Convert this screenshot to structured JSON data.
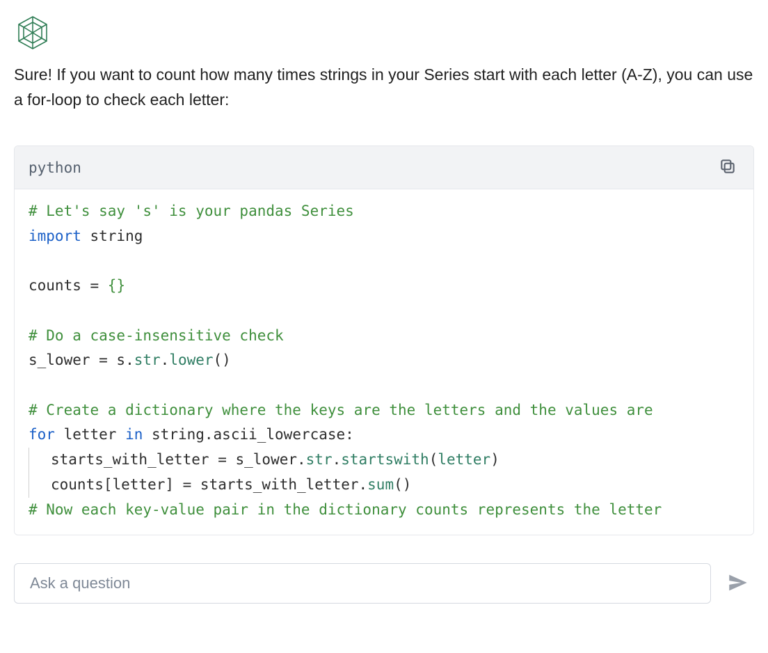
{
  "logo": {
    "name": "hex-knot-icon"
  },
  "answer": {
    "text": "Sure! If you want to count how many times strings in your Series start with each letter (A-Z), you can use a for-loop to check each letter:"
  },
  "code_block": {
    "language": "python",
    "copy_label": "Copy",
    "lines": {
      "c1": "# Let's say 's' is your pandas Series",
      "kw_import": "import",
      "mod_string": " string",
      "counts_eq": "counts = ",
      "braces": "{}",
      "c2": "# Do a case-insensitive check",
      "sl_pre": "s_lower = s.",
      "sl_str": "str",
      "sl_dot": ".",
      "sl_lower": "lower",
      "sl_paren": "()",
      "c3": "# Create a dictionary where the keys are the letters and the values are",
      "kw_for": "for",
      "for_mid": " letter ",
      "kw_in": "in",
      "for_tail": " string.ascii_lowercase:",
      "l_sw_pre": "starts_with_letter = s_lower.",
      "l_sw_str": "str",
      "l_sw_dot": ".",
      "l_sw_sw": "startswith",
      "l_sw_paren_open": "(",
      "l_sw_arg": "letter",
      "l_sw_paren_close": ")",
      "l_cnt_pre": "counts[letter] = starts_with_letter.",
      "l_cnt_sum": "sum",
      "l_cnt_paren": "()",
      "c4": "# Now each key-value pair in the dictionary counts represents the letter"
    }
  },
  "input": {
    "placeholder": "Ask a question",
    "value": ""
  }
}
